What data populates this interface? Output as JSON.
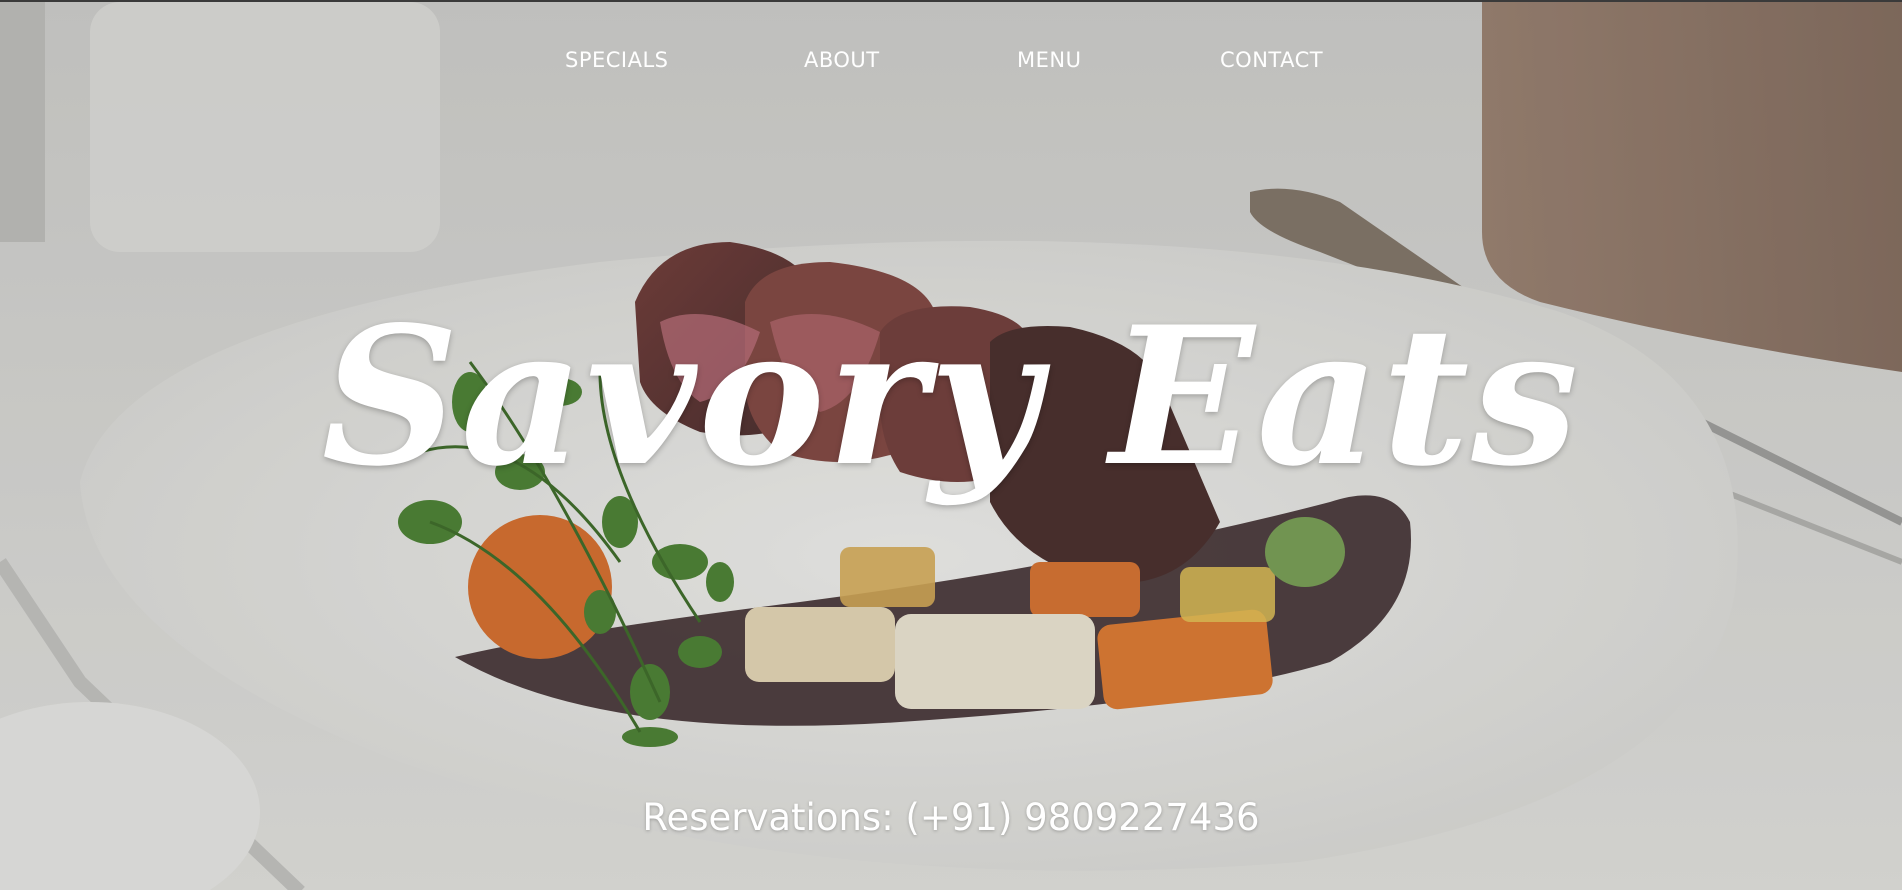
{
  "nav": {
    "items": [
      {
        "label": "SPECIALS"
      },
      {
        "label": "ABOUT"
      },
      {
        "label": "MENU"
      },
      {
        "label": "CONTACT"
      }
    ]
  },
  "hero": {
    "title": "Savory Eats",
    "reservations": "Reservations: (+91) 9809227436",
    "background_image": "plated-steak-with-vegetables-photo"
  },
  "colors": {
    "text": "#ffffff",
    "background": "#d4d4d0",
    "plate": "#efefec",
    "meat": "#5a2a24",
    "sauce": "#2e1a1c",
    "carrot": "#d8661e",
    "greens": "#3f7a24",
    "wood": "#7a5a45"
  }
}
